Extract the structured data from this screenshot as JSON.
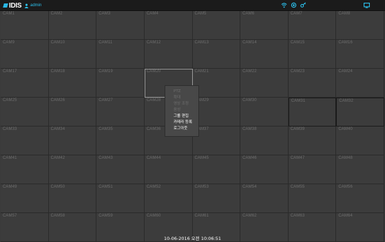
{
  "header": {
    "logo_text": "IDIS",
    "user": "admin",
    "status_icons": [
      "wifi-icon",
      "record-icon",
      "key-icon"
    ],
    "layout_icon": "screen-layout-icon",
    "accent_color": "#2cc3f0"
  },
  "cameras": [
    "CAM1",
    "CAM2",
    "CAM3",
    "CAM4",
    "CAM5",
    "CAM6",
    "CAM7",
    "CAM8",
    "CAM9",
    "CAM10",
    "CAM11",
    "CAM12",
    "CAM13",
    "CAM14",
    "CAM15",
    "CAM16",
    "CAM17",
    "CAM18",
    "CAM19",
    "CAM20",
    "CAM21",
    "CAM22",
    "CAM23",
    "CAM24",
    "CAM25",
    "CAM26",
    "CAM27",
    "CAM28",
    "CAM29",
    "CAM30",
    "CAM31",
    "CAM32",
    "CAM33",
    "CAM34",
    "CAM35",
    "CAM36",
    "CAM37",
    "CAM38",
    "CAM39",
    "CAM40",
    "CAM41",
    "CAM42",
    "CAM43",
    "CAM44",
    "CAM45",
    "CAM46",
    "CAM47",
    "CAM48",
    "CAM49",
    "CAM50",
    "CAM51",
    "CAM52",
    "CAM53",
    "CAM54",
    "CAM55",
    "CAM56",
    "CAM57",
    "CAM58",
    "CAM59",
    "CAM60",
    "CAM61",
    "CAM62",
    "CAM63",
    "CAM64"
  ],
  "selected_camera": "CAM20",
  "context_menu": {
    "items": [
      {
        "label": "PTZ",
        "enabled": false
      },
      {
        "label": "확대",
        "enabled": false
      },
      {
        "label": "영상 조정",
        "enabled": false
      },
      {
        "label": "음성",
        "enabled": false
      },
      {
        "label": "그룹 편집",
        "enabled": true
      },
      {
        "label": "카메라 등록",
        "enabled": true
      },
      {
        "label": "로그아웃",
        "enabled": true
      }
    ]
  },
  "footer": {
    "datetime": "10-06-2016 오전 10:06:51"
  }
}
